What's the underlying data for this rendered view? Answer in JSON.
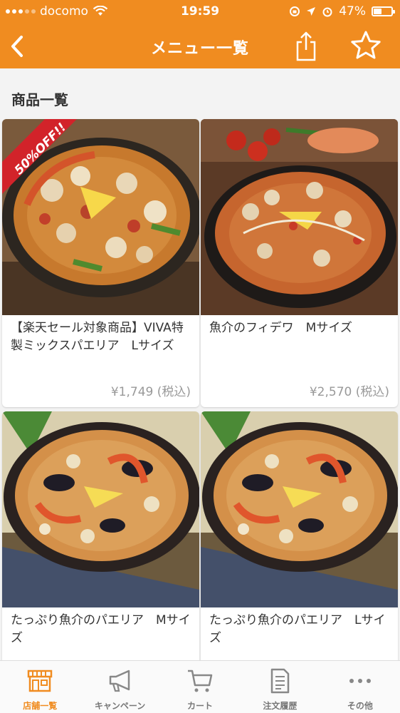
{
  "status_bar": {
    "carrier": "docomo",
    "time": "19:59",
    "battery_percent": "47%",
    "battery_level": 0.47
  },
  "nav": {
    "title": "メニュー一覧",
    "back_icon": "chevron-left-icon",
    "share_icon": "share-icon",
    "favorite_icon": "star-outline-icon"
  },
  "section": {
    "title": "商品一覧"
  },
  "products": [
    {
      "name": "【楽天セール対象商品】VIVA特製ミックスパエリア　Lサイズ",
      "price": "¥1,749 (税込)",
      "badge": "50%OFF!!"
    },
    {
      "name": "魚介のフィデワ　Mサイズ",
      "price": "¥2,570 (税込)"
    },
    {
      "name": "たっぷり魚介のパエリア　Mサイズ"
    },
    {
      "name": "たっぷり魚介のパエリア　Lサイズ"
    }
  ],
  "tabs": [
    {
      "label": "店舗一覧",
      "icon": "store-icon",
      "active": true
    },
    {
      "label": "キャンペーン",
      "icon": "megaphone-icon",
      "active": false
    },
    {
      "label": "カート",
      "icon": "cart-icon",
      "active": false
    },
    {
      "label": "注文履歴",
      "icon": "document-icon",
      "active": false
    },
    {
      "label": "その他",
      "icon": "more-icon",
      "active": false
    }
  ],
  "colors": {
    "brand": "#f08c20",
    "background": "#f3f3f3",
    "text": "#333333",
    "price": "#999999",
    "badge": "#d2232a"
  }
}
